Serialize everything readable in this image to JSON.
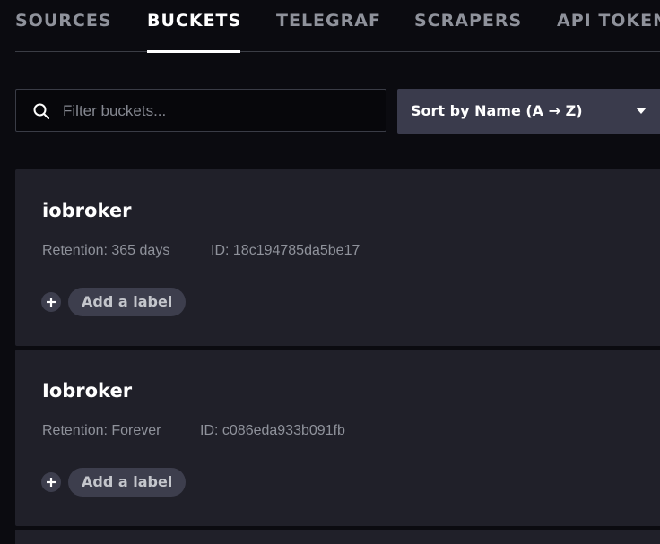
{
  "tabs": [
    {
      "label": "SOURCES",
      "active": false
    },
    {
      "label": "BUCKETS",
      "active": true
    },
    {
      "label": "TELEGRAF",
      "active": false
    },
    {
      "label": "SCRAPERS",
      "active": false
    },
    {
      "label": "API TOKENS",
      "active": false
    }
  ],
  "search": {
    "placeholder": "Filter buckets...",
    "value": "",
    "icon": "search-icon"
  },
  "sort": {
    "label": "Sort by Name (A → Z)",
    "icon": "chevron-down-icon"
  },
  "buckets": [
    {
      "name": "iobroker",
      "retention": "Retention: 365 days",
      "id": "ID: 18c194785da5be17",
      "add_label": "Add a label"
    },
    {
      "name": "Iobroker",
      "retention": "Retention: Forever",
      "id": "ID: c086eda933b091fb",
      "add_label": "Add a label"
    }
  ],
  "colors": {
    "background": "#0b0b10",
    "card": "#202029",
    "sort_button": "#3a3b4c",
    "muted_text": "#8f929b"
  }
}
